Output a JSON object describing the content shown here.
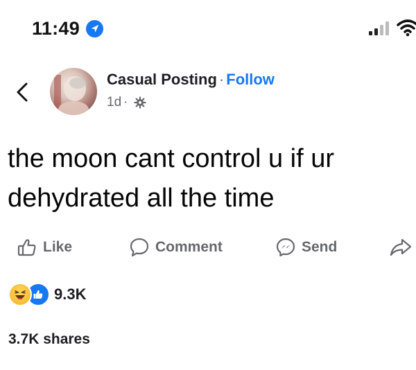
{
  "status_bar": {
    "time": "11:49"
  },
  "post": {
    "author": "Casual Posting",
    "follow_label": "Follow",
    "timestamp": "1d",
    "text": "the moon cant control u if ur dehydrated all the time"
  },
  "actions": {
    "like_label": "Like",
    "comment_label": "Comment",
    "send_label": "Send"
  },
  "engagement": {
    "reactions_count": "9.3K",
    "shares_label": "3.7K shares"
  },
  "icons": [
    "location-arrow-icon",
    "signal-icon",
    "wifi-icon",
    "back-icon",
    "globe-gear-icon",
    "like-icon",
    "comment-icon",
    "messenger-icon",
    "share-icon",
    "haha-reaction-icon",
    "like-reaction-icon"
  ],
  "colors": {
    "link": "#1877f2",
    "secondary_text": "#65676b",
    "reaction_like": "#1877f2",
    "reaction_haha": "#f7b125"
  }
}
